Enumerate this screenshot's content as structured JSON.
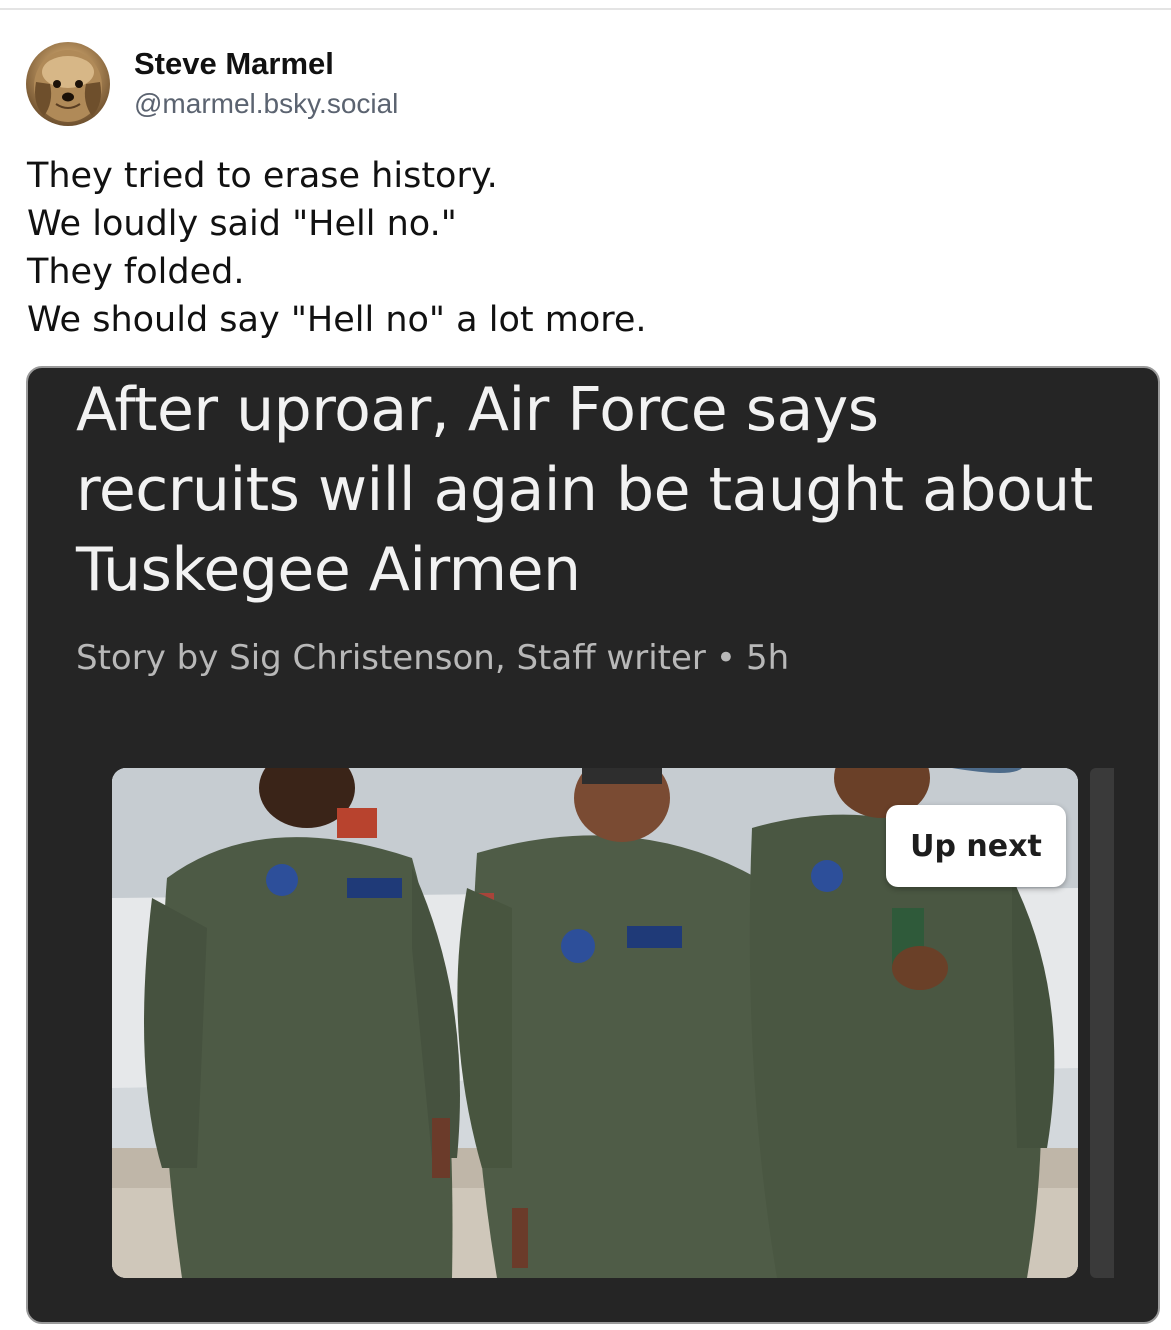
{
  "post": {
    "author": {
      "display_name": "Steve Marmel",
      "handle": "@marmel.bsky.social"
    },
    "text_lines": [
      "They tried to erase history.",
      "We loudly said \"Hell no.\"",
      "They folded.",
      "We should say \"Hell no\" a lot more."
    ]
  },
  "article": {
    "headline": "After uproar, Air Force says recruits will again be taught about Tuskegee Airmen",
    "byline": "Story by Sig Christenson, Staff writer",
    "separator": "•",
    "age": "5h",
    "up_next_label": "Up next"
  },
  "colors": {
    "card_background": "#252525",
    "headline_text": "#f2f2f2",
    "byline_text": "#b8b8b8",
    "flight_suit": "#4d5a45"
  }
}
